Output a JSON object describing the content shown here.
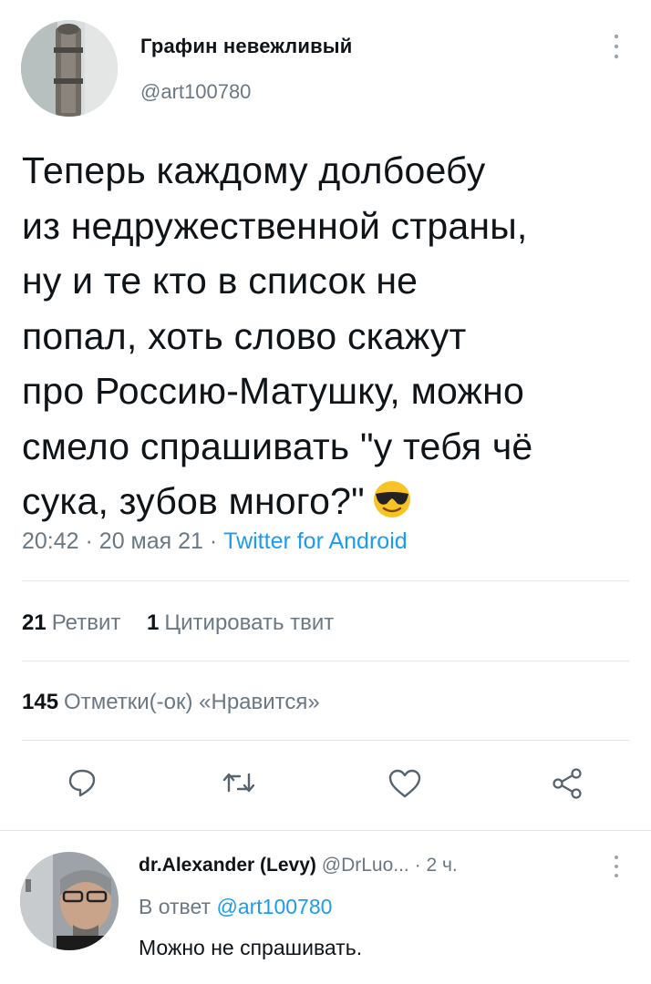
{
  "tweet": {
    "author_name": "Графин невежливый",
    "author_handle": "@art100780",
    "text_lines": [
      "Теперь каждому долбоебу",
      "из недружественной страны,",
      "ну и те кто в список не",
      "попал, хоть слово скажут",
      "про Россию-Матушку, можно",
      "смело спрашивать \"у тебя чё",
      "сука, зубов много?\""
    ],
    "emoji": "sunglasses-emoji",
    "time": "20:42",
    "separator": "·",
    "date": "20 мая 21",
    "source": "Twitter for Android"
  },
  "stats": {
    "retweets_count": "21",
    "retweets_label": "Ретвит",
    "quotes_count": "1",
    "quotes_label": "Цитировать твит",
    "likes_count": "145",
    "likes_label": "Отметки(-ок) «Нравится»"
  },
  "actions": [
    "reply-icon",
    "retweet-icon",
    "like-icon",
    "share-icon"
  ],
  "reply": {
    "name": "dr.Alexander (Levy)",
    "handle": "@DrLuo...",
    "time": "· 2 ч.",
    "in_reply_label": "В ответ",
    "in_reply_handle": "@art100780",
    "text": "Можно не спрашивать."
  },
  "colors": {
    "link": "#1d9bf0",
    "secondary_text": "#6b7883",
    "primary_text": "#0f1419",
    "divider": "#e3e6e8"
  }
}
